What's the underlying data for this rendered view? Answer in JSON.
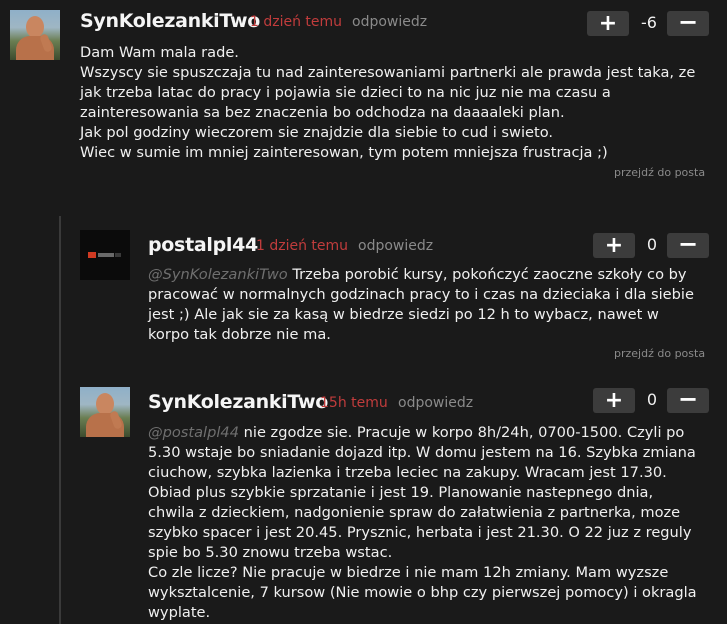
{
  "comments": [
    {
      "author": "SynKolezankiTwo",
      "time": "1 dzień temu",
      "reply": "odpowiedz",
      "score": "-6",
      "upvote": "+",
      "downvote": "−",
      "goto": "przejdź do posta",
      "lines": [
        "Dam Wam mala rade.",
        "Wszyscy sie spuszczaja tu nad zainteresowaniami partnerki ale prawda jest taka, ze",
        "jak trzeba latac do pracy i pojawia sie dzieci to na nic juz nie ma czasu a",
        "zainteresowania sa bez znaczenia bo odchodza na daaaaleki plan.",
        "Jak pol godziny wieczorem sie znajdzie dla siebie to cud i swieto.",
        "Wiec w sumie im mniej zainteresowan, tym potem mniejsza frustracja ;)"
      ]
    },
    {
      "author": "postalpl44",
      "time": "1 dzień temu",
      "reply": "odpowiedz",
      "score": "0",
      "upvote": "+",
      "downvote": "−",
      "goto": "przejdź do posta",
      "mention": "@SynKolezankiTwo",
      "lines": [
        " Trzeba porobić kursy, pokończyć zaoczne szkoły co by",
        "pracować w normalnych godzinach pracy to i czas na dzieciaka i dla siebie",
        "jest ;) Ale jak sie za kasą w biedrze siedzi po 12 h to wybacz, nawet w",
        "korpo tak dobrze nie ma."
      ]
    },
    {
      "author": "SynKolezankiTwo",
      "time": "15h temu",
      "reply": "odpowiedz",
      "score": "0",
      "upvote": "+",
      "downvote": "−",
      "mention": "@postalpl44",
      "lines": [
        " nie zgodze sie. Pracuje w korpo 8h/24h, 0700-1500. Czyli po",
        "5.30 wstaje bo sniadanie dojazd itp. W domu jestem na 16. Szybka zmiana",
        "ciuchow, szybka lazienka i trzeba leciec na zakupy. Wracam jest 17.30.",
        "Obiad plus szybkie sprzatanie i jest 19. Planowanie nastepnego dnia,",
        "chwila z dzieckiem, nadgonienie spraw do załatwienia z partnerka, moze",
        "szybko spacer i jest 20.45. Prysznic, herbata i jest 21.30. O 22 juz z reguly",
        "spie bo 5.30 znowu trzeba wstac.",
        "Co zle licze? Nie pracuje w biedrze i nie mam 12h zmiany. Mam wyzsze",
        "wyksztalcenie, 7 kursow (Nie mowie o bhp czy pierwszej pomocy) i okragla",
        "wyplate."
      ]
    }
  ]
}
